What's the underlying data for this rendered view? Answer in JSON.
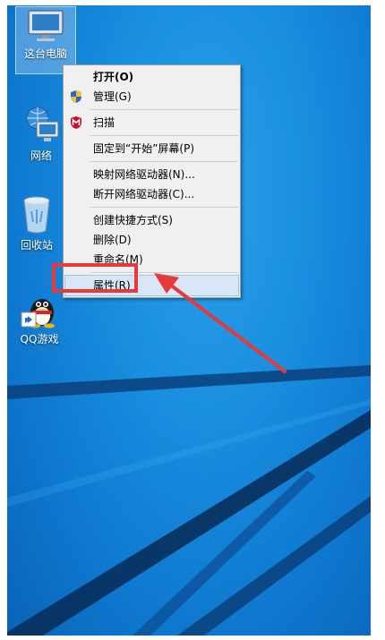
{
  "desktop": {
    "icons": [
      {
        "label": "这台电脑",
        "icon": "computer-icon"
      },
      {
        "label": "网络",
        "icon": "network-icon"
      },
      {
        "label": "回收站",
        "icon": "recycle-bin-icon"
      },
      {
        "label": "QQ游戏",
        "icon": "qq-game-icon"
      }
    ]
  },
  "menu": {
    "items": [
      {
        "label": "打开(O)",
        "icon": ""
      },
      {
        "label": "管理(G)",
        "icon": "uac-shield-icon"
      },
      {
        "label": "扫描",
        "icon": "mcafee-icon"
      },
      {
        "label": "固定到“开始”屏幕(P)",
        "icon": ""
      },
      {
        "label": "映射网络驱动器(N)...",
        "icon": ""
      },
      {
        "label": "断开网络驱动器(C)...",
        "icon": ""
      },
      {
        "label": "创建快捷方式(S)",
        "icon": ""
      },
      {
        "label": "删除(D)",
        "icon": ""
      },
      {
        "label": "重命名(M)",
        "icon": ""
      },
      {
        "label": "属性(R)",
        "icon": ""
      }
    ]
  },
  "colors": {
    "annotation": "#e5393a",
    "desktop_blue": "#1a8fe0",
    "menu_bg": "#f0f0f0",
    "menu_hover": "#d9e6f5"
  }
}
